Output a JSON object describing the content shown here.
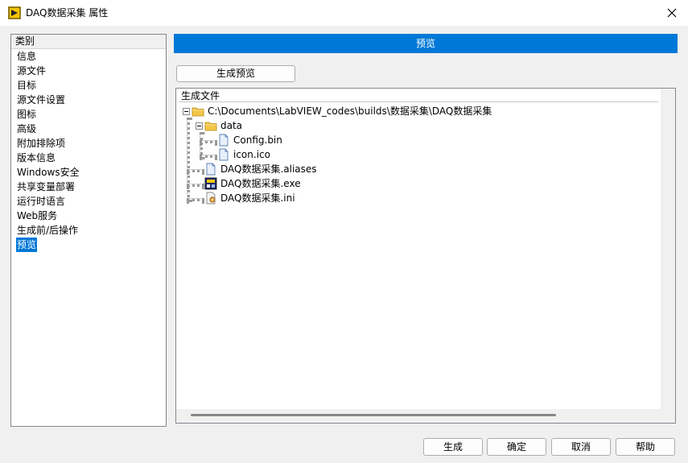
{
  "window": {
    "title": "DAQ数据采集 属性"
  },
  "sidebar": {
    "header": "类别",
    "items": [
      {
        "label": "信息"
      },
      {
        "label": "源文件"
      },
      {
        "label": "目标"
      },
      {
        "label": "源文件设置"
      },
      {
        "label": "图标"
      },
      {
        "label": "高级"
      },
      {
        "label": "附加排除项"
      },
      {
        "label": "版本信息"
      },
      {
        "label": "Windows安全"
      },
      {
        "label": "共享变量部署"
      },
      {
        "label": "运行时语言"
      },
      {
        "label": "Web服务"
      },
      {
        "label": "生成前/后操作"
      },
      {
        "label": "预览",
        "selected": true
      }
    ]
  },
  "main": {
    "section_title": "预览",
    "generate_preview_label": "生成预览",
    "files_header": "生成文件",
    "tree": {
      "root_path": "C:\\Documents\\LabVIEW_codes\\builds\\数据采集\\DAQ数据采集",
      "folder_name": "data",
      "folder_files": [
        "Config.bin",
        "icon.ico"
      ],
      "files": [
        "DAQ数据采集.aliases",
        "DAQ数据采集.exe",
        "DAQ数据采集.ini"
      ]
    }
  },
  "footer": {
    "build_label": "生成",
    "ok_label": "确定",
    "cancel_label": "取消",
    "help_label": "帮助"
  },
  "colors": {
    "accent": "#0078d7",
    "window_bg": "#f0f0f0",
    "folder": "#f3c54a"
  },
  "icons": [
    "labview-app-icon",
    "close-icon",
    "folder-icon",
    "document-icon",
    "exe-icon",
    "ini-config-icon",
    "collapse-icon"
  ]
}
